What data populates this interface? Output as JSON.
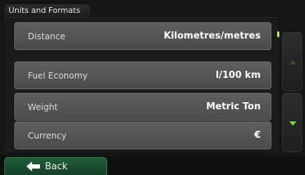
{
  "header": {
    "title": "Units and Formats"
  },
  "settings": [
    {
      "label": "Distance",
      "value": "Kilometres/metres"
    },
    {
      "label": "Fuel Economy",
      "value": "l/100 km"
    },
    {
      "label": "Weight",
      "value": "Metric Ton"
    },
    {
      "label": "Currency",
      "value": "€"
    }
  ],
  "footer": {
    "back_label": "Back"
  },
  "colors": {
    "accent_green": "#7fdc2f",
    "back_button_green": "#1f5e39",
    "row_gray": "#555555",
    "background": "#151515"
  },
  "icons": {
    "scroll_up": "chevron-up-icon",
    "scroll_down": "chevron-down-icon",
    "back": "arrow-left-icon"
  }
}
